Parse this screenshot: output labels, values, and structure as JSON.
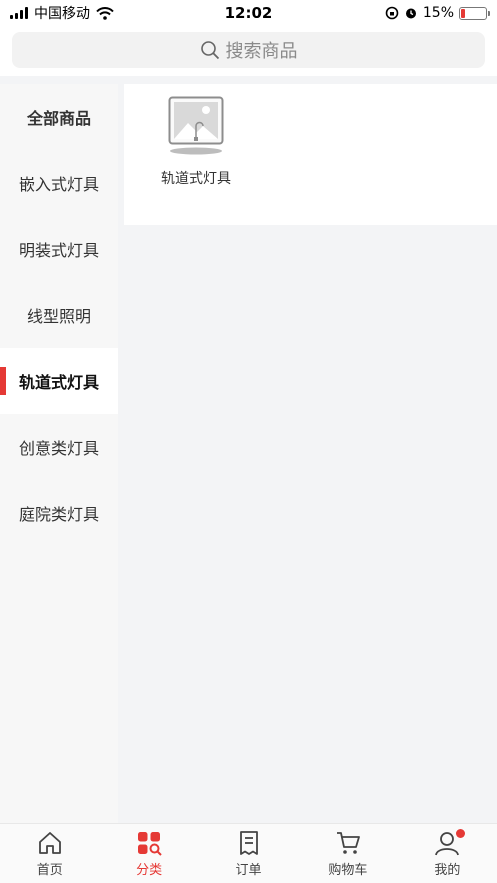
{
  "status_bar": {
    "carrier": "中国移动",
    "time": "12:02",
    "battery": "15%",
    "battery_level": 0.15
  },
  "search": {
    "placeholder": "搜索商品"
  },
  "sidebar": {
    "items": [
      {
        "label": "全部商品"
      },
      {
        "label": "嵌入式灯具"
      },
      {
        "label": "明装式灯具"
      },
      {
        "label": "线型照明"
      },
      {
        "label": "轨道式灯具"
      },
      {
        "label": "创意类灯具"
      },
      {
        "label": "庭院类灯具"
      }
    ],
    "active_index": 4
  },
  "content": {
    "products": [
      {
        "name": "轨道式灯具",
        "icon": "image-placeholder-icon"
      }
    ]
  },
  "tabbar": {
    "items": [
      {
        "label": "首页",
        "icon": "home-icon"
      },
      {
        "label": "分类",
        "icon": "category-icon"
      },
      {
        "label": "订单",
        "icon": "order-icon"
      },
      {
        "label": "购物车",
        "icon": "cart-icon"
      },
      {
        "label": "我的",
        "icon": "profile-icon"
      }
    ],
    "active_index": 1
  },
  "colors": {
    "accent": "#e53935",
    "sidebar_bg": "#f7f7f7",
    "page_bg": "#f3f4f6"
  }
}
